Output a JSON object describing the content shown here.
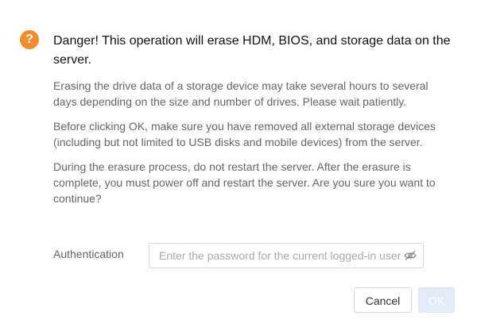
{
  "dialog": {
    "icon_symbol": "?",
    "icon_color": "#f08c2c",
    "title": "Danger! This operation will erase HDM, BIOS, and storage data on the server.",
    "paragraphs": [
      "Erasing the drive data of a storage device may take several hours to several days depending on the size and number of drives. Please wait patiently.",
      "Before clicking OK, make sure you have removed all external storage devices (including but not limited to USB disks and mobile devices) from the server.",
      "During the erasure process, do not restart the server. After the erasure is complete, you must power off and restart the server. Are you sure you want to continue?"
    ],
    "authentication": {
      "label": "Authentication",
      "placeholder": "Enter the password for the current logged-in user",
      "value": ""
    },
    "buttons": {
      "cancel_label": "Cancel",
      "ok_label": "OK",
      "ok_disabled": true
    }
  }
}
